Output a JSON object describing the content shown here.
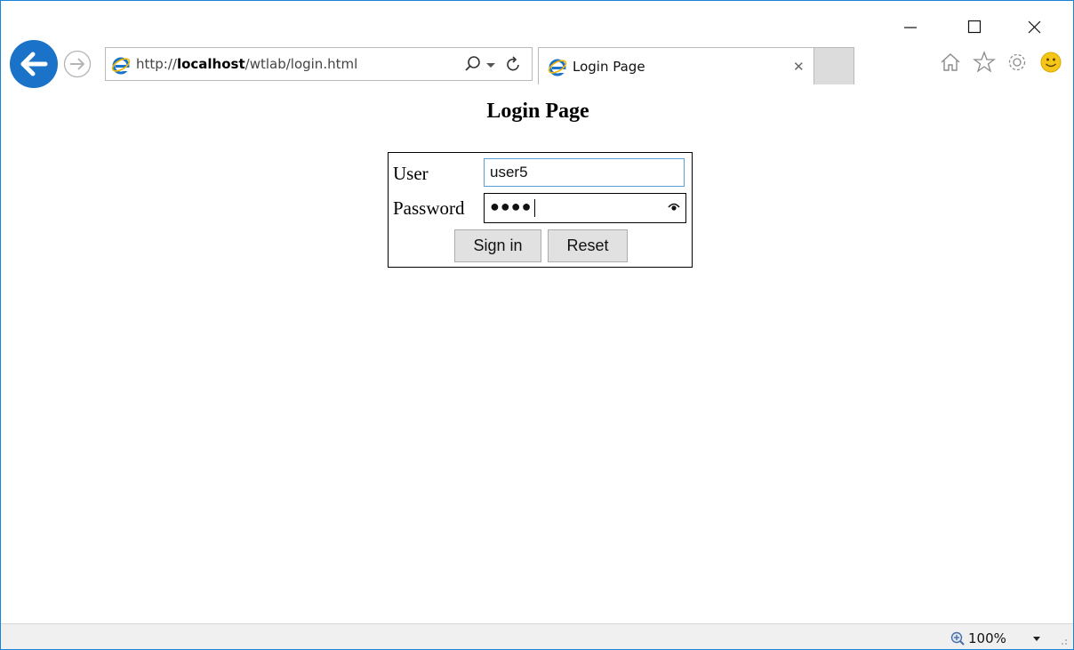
{
  "browser": {
    "address": {
      "prefix": "http://",
      "host": "localhost",
      "path": "/wtlab/login.html"
    },
    "tab": {
      "title": "Login Page"
    },
    "zoom": "100%"
  },
  "page": {
    "heading": "Login Page",
    "form": {
      "user_label": "User",
      "user_value": "user5",
      "password_label": "Password",
      "password_masked": "●●●●",
      "signin_label": "Sign in",
      "reset_label": "Reset"
    }
  },
  "colors": {
    "accent": "#1883d7",
    "ie_blue": "#1a73c8",
    "smiley": "#f5c518"
  },
  "icons": [
    "back-arrow-icon",
    "forward-arrow-icon",
    "ie-logo-icon",
    "search-icon",
    "dropdown-icon",
    "refresh-icon",
    "close-icon",
    "home-icon",
    "favorites-star-icon",
    "settings-gear-icon",
    "feedback-smiley-icon",
    "zoom-icon",
    "minimize-icon",
    "maximize-icon",
    "window-close-icon",
    "password-reveal-icon",
    "resize-grip-icon"
  ]
}
